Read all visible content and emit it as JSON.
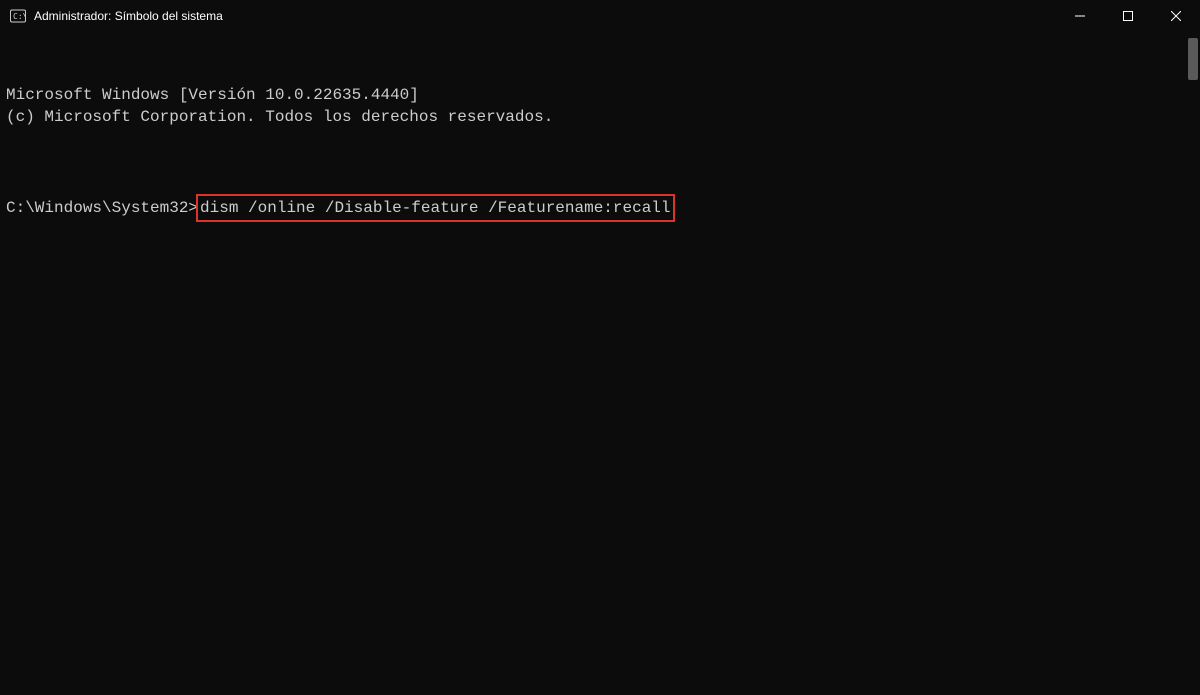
{
  "titlebar": {
    "title": "Administrador: Símbolo del sistema"
  },
  "terminal": {
    "line1": "Microsoft Windows [Versión 10.0.22635.4440]",
    "line2": "(c) Microsoft Corporation. Todos los derechos reservados.",
    "prompt_path": "C:\\Windows\\System32>",
    "typed_command": "dism /online /Disable-feature /Featurename:recall"
  }
}
